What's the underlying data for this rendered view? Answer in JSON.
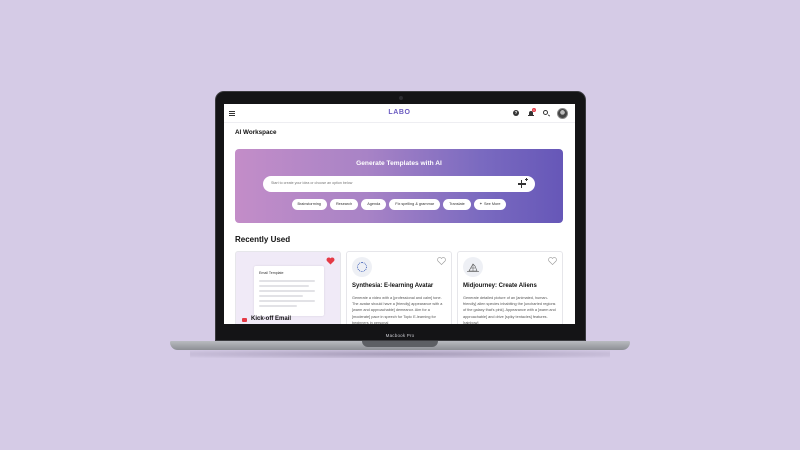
{
  "device": {
    "model_label": "Macbook Pro"
  },
  "app": {
    "logo": "LABO",
    "notification_count": "1"
  },
  "page": {
    "title": "AI Workspace"
  },
  "hero": {
    "title": "Generate Templates with AI",
    "input_placeholder": "Start to create your idea or choose an option below",
    "chips": [
      "Brainstorming",
      "Research",
      "Agenda",
      "Fix spelling & grammar",
      "Translate",
      "See More"
    ]
  },
  "recently_used": {
    "title": "Recently Used",
    "cards": [
      {
        "title": "Kick-off Email",
        "preview_title": "Email Template",
        "favorited": true,
        "icon": "mail-icon"
      },
      {
        "title": "Synthesia: E-learning Avatar",
        "description": "Generate a video with a [professional and calm] tone. The avatar should have a [friendly] appearance with a [warm and approachable] demeanor. Aim for a [moderate] pace in speech for Topic E-learning for beginners in personal",
        "favorited": false,
        "icon": "loading-icon"
      },
      {
        "title": "Midjourney: Create Aliens",
        "description": "Generate detailed picture of an [animated, human-friendly] alien species inhabiting the [uncharted regions of the galaxy that's pink]. Appearance with a [warm and approachable] and drive [spiky tentacles] features. [rainbow]",
        "favorited": false,
        "icon": "ship-icon"
      }
    ]
  },
  "colors": {
    "background": "#d5cbe6",
    "brand": "#6a5ac0",
    "hero_gradient_start": "#c38dc8",
    "hero_gradient_end": "#6657b8",
    "favorite": "#e53945"
  }
}
